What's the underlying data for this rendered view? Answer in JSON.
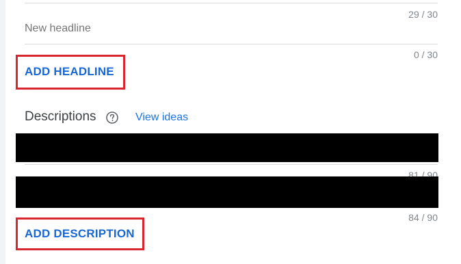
{
  "headlines": {
    "counter_top": "29 / 30",
    "new_headline_placeholder": "New headline",
    "counter_new": "0 / 30",
    "add_button": "ADD HEADLINE"
  },
  "descriptions": {
    "title": "Descriptions",
    "view_ideas": "View ideas",
    "counter_1": "81 / 90",
    "counter_2": "84 / 90",
    "add_button": "ADD DESCRIPTION"
  },
  "colors": {
    "link": "#1a73e8",
    "highlight_box": "#d8262e",
    "redaction": "#000000"
  },
  "icons": {
    "help": "question-circle-icon"
  }
}
